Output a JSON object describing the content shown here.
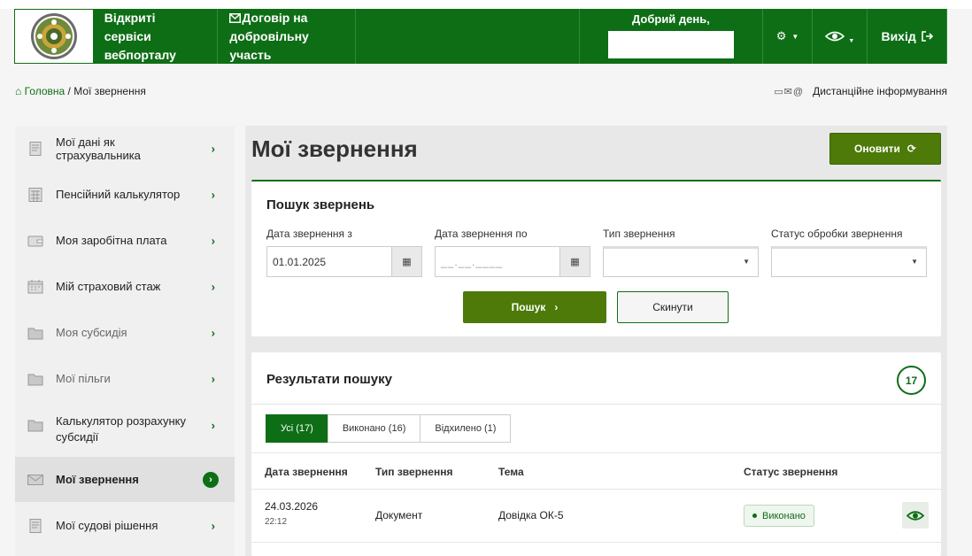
{
  "header": {
    "services_label": "Відкриті сервіси вебпорталу",
    "contract_label": "Договір на добровільну участь",
    "greeting": "Добрий день,",
    "exit_label": "Вихід"
  },
  "breadcrumb": {
    "home": "Головна",
    "separator": "/",
    "current": "Мої звернення"
  },
  "distance_info": "Дистанційне інформування",
  "sidebar": {
    "items": [
      {
        "label": "Мої дані як страхувальника"
      },
      {
        "label": "Пенсійний калькулятор"
      },
      {
        "label": "Моя заробітна плата"
      },
      {
        "label": "Мій страховий стаж"
      },
      {
        "label": "Моя субсидія"
      },
      {
        "label": "Мої пільги"
      },
      {
        "label": "Калькулятор розрахунку субсидії"
      },
      {
        "label": "Мої звернення"
      },
      {
        "label": "Мої судові рішення"
      }
    ]
  },
  "page": {
    "title": "Мої звернення",
    "refresh_label": "Оновити"
  },
  "search": {
    "title": "Пошук звернень",
    "date_from_label": "Дата звернення з",
    "date_from_value": "01.01.2025",
    "date_to_label": "Дата звернення по",
    "date_to_placeholder": "__.__.____",
    "type_label": "Тип звернення",
    "status_label": "Статус обробки звернення",
    "search_button": "Пошук",
    "reset_button": "Скинути"
  },
  "results": {
    "title": "Результати пошуку",
    "count": "17",
    "tabs": [
      {
        "label": "Усі (17)"
      },
      {
        "label": "Виконано (16)"
      },
      {
        "label": "Відхилено (1)"
      }
    ],
    "columns": [
      "Дата звернення",
      "Тип звернення",
      "Тема",
      "Статус звернення"
    ],
    "rows": [
      {
        "date": "24.03.2026",
        "time": "22:12",
        "type": "Документ",
        "topic": "Довідка ОК-5",
        "status": "Виконано"
      }
    ]
  },
  "colors": {
    "brand_green": "#0e6e16",
    "button_green": "#4d7a08"
  }
}
